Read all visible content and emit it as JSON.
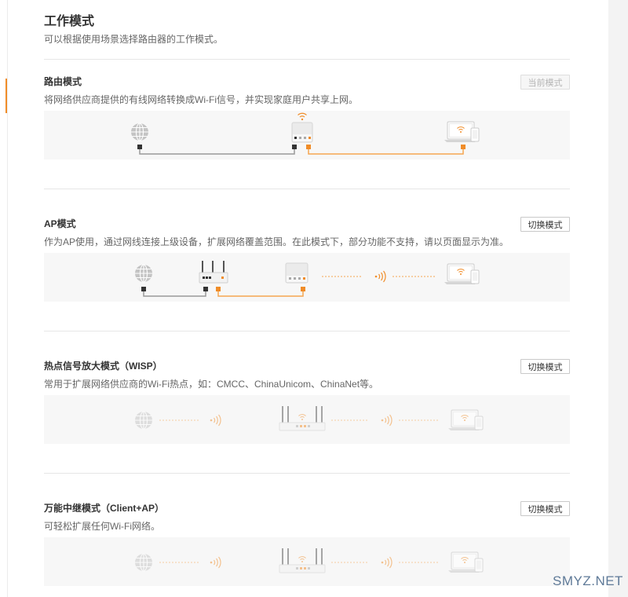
{
  "page": {
    "title": "工作模式",
    "subtitle": "可以根据使用场景选择路由器的工作模式。"
  },
  "colors": {
    "accent": "#f08c28",
    "accent_light": "#f5a650",
    "title_text": "#333333",
    "description_text": "#666666",
    "diagram_background": "#f7f7f7",
    "divider": "#e6e6e6"
  },
  "modes": [
    {
      "name": "路由模式",
      "description": "将网络供应商提供的有线网络转换成Wi-Fi信号，并实现家庭用户共享上网。",
      "button_label": "当前模式",
      "is_current": true
    },
    {
      "name": "AP模式",
      "description": "作为AP使用，通过网线连接上级设备，扩展网络覆盖范围。在此模式下，部分功能不支持，请以页面显示为准。",
      "button_label": "切换模式",
      "is_current": false
    },
    {
      "name": "热点信号放大模式（WISP）",
      "description": "常用于扩展网络供应商的Wi-Fi热点，如：CMCC、ChinaUnicom、ChinaNet等。",
      "button_label": "切换模式",
      "is_current": false
    },
    {
      "name": "万能中继模式（Client+AP）",
      "description": "可轻松扩展任何Wi-Fi网络。",
      "button_label": "切换模式",
      "is_current": false
    }
  ],
  "icons": [
    "globe-icon",
    "router-icon",
    "wifi-icon",
    "wireless-signal-icon",
    "laptop-icon",
    "phone-icon"
  ],
  "watermark": "SMYZ.NET"
}
